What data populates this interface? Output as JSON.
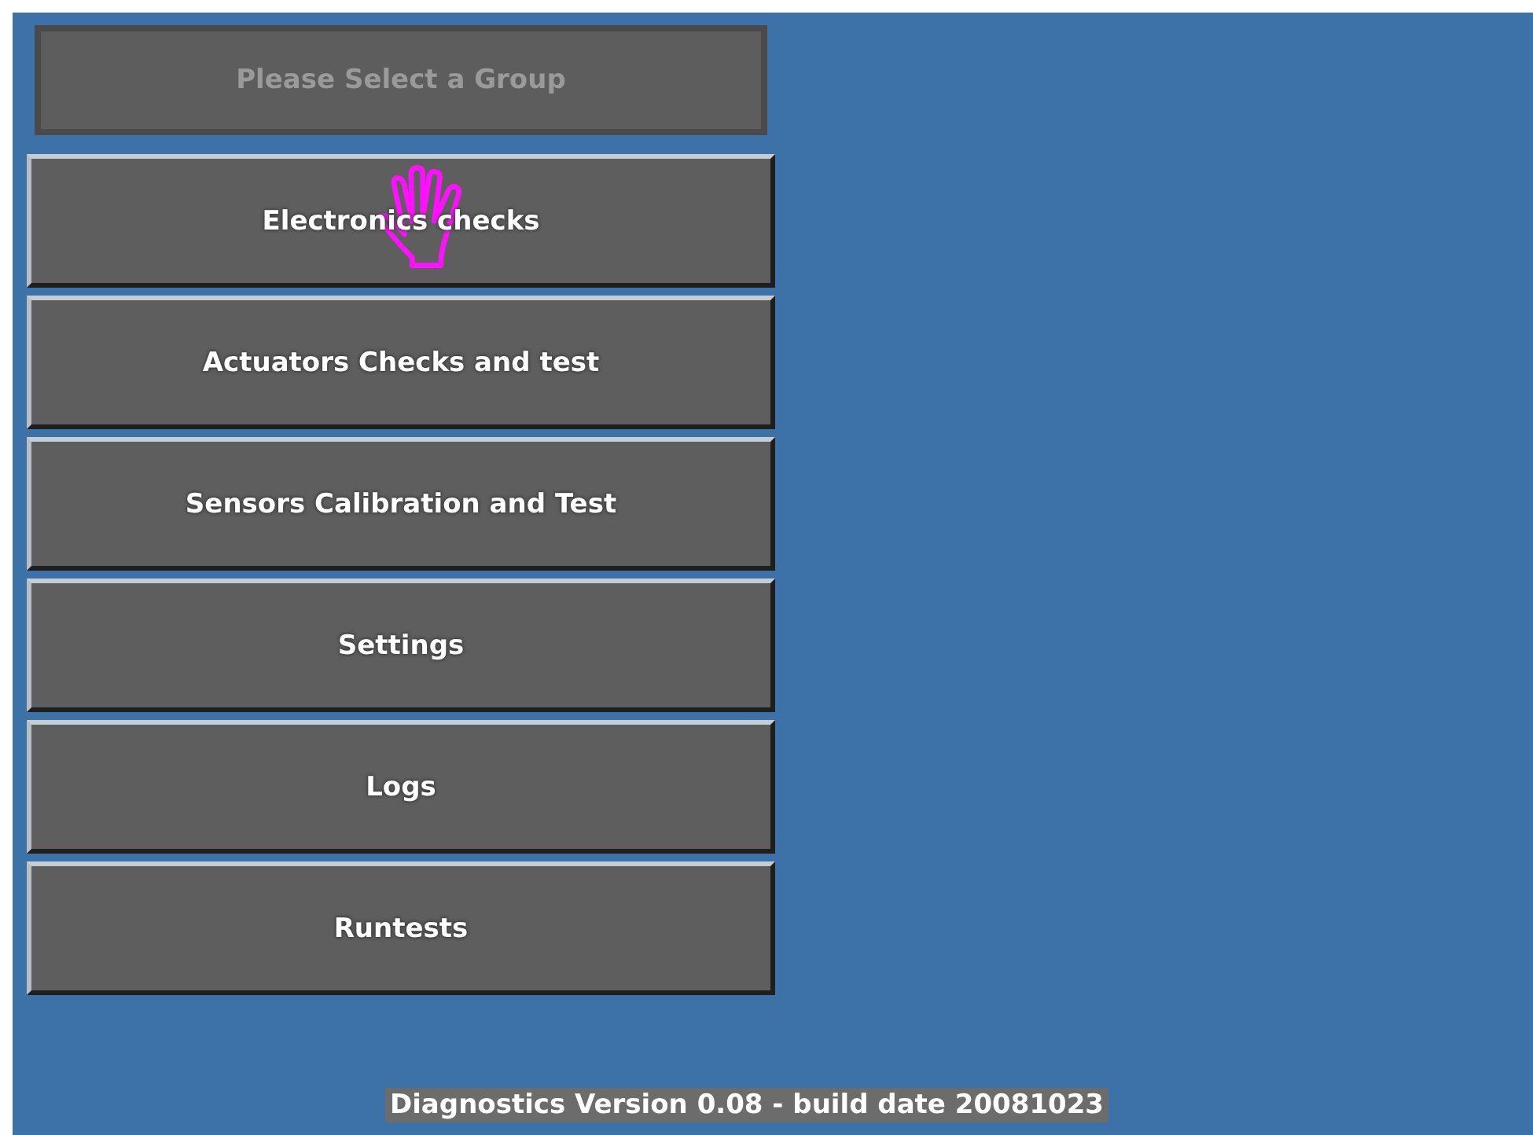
{
  "header": {
    "label": "Please Select a Group",
    "disabled": true
  },
  "groups": [
    {
      "label": "Electronics checks",
      "hovered": true
    },
    {
      "label": "Actuators Checks and test",
      "hovered": false
    },
    {
      "label": "Sensors Calibration and Test",
      "hovered": false
    },
    {
      "label": "Settings",
      "hovered": false
    },
    {
      "label": "Logs",
      "hovered": false
    },
    {
      "label": "Runtests",
      "hovered": false
    }
  ],
  "footer": "Diagnostics Version 0.08 - build date 20081023"
}
